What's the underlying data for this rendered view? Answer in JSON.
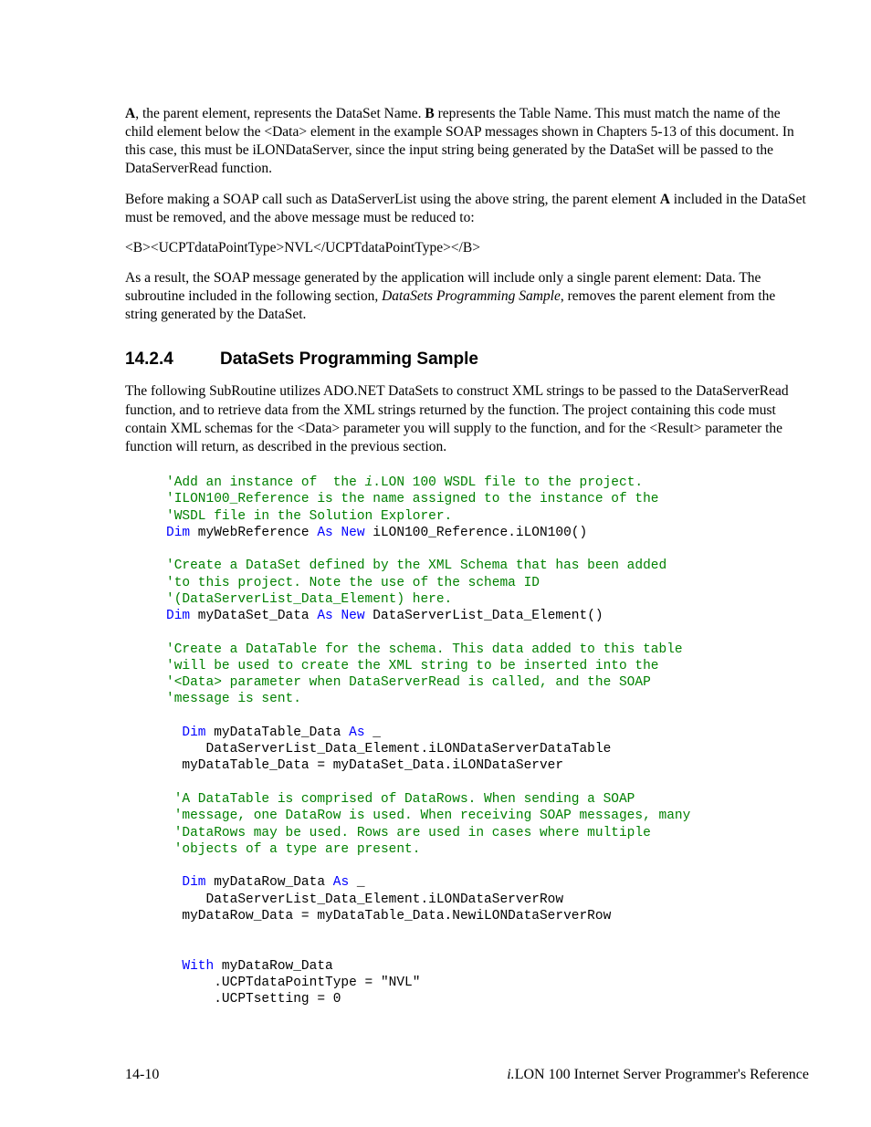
{
  "para1": {
    "b1": "A",
    "t1": ", the parent element, represents the DataSet Name. ",
    "b2": "B",
    "t2": " represents the Table Name. This must match the name of the child element below the <Data> element in the example SOAP messages shown in Chapters 5-13 of this document. In this case, this must be iLONDataServer, since the input string being generated by the DataSet will be passed to the DataServerRead function."
  },
  "para2": {
    "t1": "Before making a SOAP call such as DataServerList using the above string, the parent element ",
    "b1": "A",
    "t2": " included in the DataSet must be removed, and the above message must be reduced to:"
  },
  "para3": "<B><UCPTdataPointType>NVL</UCPTdataPointType></B>",
  "para4": {
    "t1": "As a result, the SOAP message generated by the application will include only a single parent element: Data. The subroutine included in the following section, ",
    "i1": "DataSets Programming Sample",
    "t2": ", removes the parent element from the string generated by the DataSet."
  },
  "heading": {
    "num": "14.2.4",
    "title": "DataSets Programming Sample"
  },
  "para5": "The following SubRoutine utilizes ADO.NET DataSets to construct XML strings to be passed to the DataServerRead function, and to retrieve data from the XML strings returned by the function. The project containing this code must contain XML schemas for the <Data> parameter you will supply to the function, and for the <Result> parameter the function will return, as described in the previous section.",
  "code": {
    "c1a": "'Add an instance of  the ",
    "c1i": "i",
    "c1b": ".LON 100 WSDL file to the project.",
    "c2": "'ILON100_Reference is the name assigned to the instance of the",
    "c3": "'WSDL file in the Solution Explorer.",
    "l4a": "Dim",
    "l4b": " myWebReference ",
    "l4c": "As",
    "l4d": " ",
    "l4e": "New",
    "l4f": " iLON100_Reference.iLON100()",
    "c5": "'Create a DataSet defined by the XML Schema that has been added",
    "c6": "'to this project. Note the use of the schema ID",
    "c7": "'(DataServerList_Data_Element) here.",
    "l8a": "Dim",
    "l8b": " myDataSet_Data ",
    "l8c": "As",
    "l8d": " ",
    "l8e": "New",
    "l8f": " DataServerList_Data_Element()",
    "c9": "'Create a DataTable for the schema. This data added to this table",
    "c10": "'will be used to create the XML string to be inserted into the",
    "c11": "'<Data> parameter when DataServerRead is called, and the SOAP",
    "c12": "'message is sent.",
    "l13a": "  Dim",
    "l13b": " myDataTable_Data ",
    "l13c": "As",
    "l13d": " _",
    "l14": "     DataServerList_Data_Element.iLONDataServerDataTable",
    "l15": "  myDataTable_Data = myDataSet_Data.iLONDataServer",
    "c16": " 'A DataTable is comprised of DataRows. When sending a SOAP",
    "c17": " 'message, one DataRow is used. When receiving SOAP messages, many",
    "c18": " 'DataRows may be used. Rows are used in cases where multiple",
    "c19": " 'objects of a type are present.",
    "l20a": "  Dim",
    "l20b": " myDataRow_Data ",
    "l20c": "As",
    "l20d": " _",
    "l21": "     DataServerList_Data_Element.iLONDataServerRow",
    "l22": "  myDataRow_Data = myDataTable_Data.NewiLONDataServerRow",
    "l23a": "  With",
    "l23b": " myDataRow_Data",
    "l24": "      .UCPTdataPointType = \"NVL\"",
    "l25": "      .UCPTsetting = 0"
  },
  "footer": {
    "page": "14-10",
    "ref_i": "i.",
    "ref_rest": "LON 100 Internet Server Programmer's Reference"
  }
}
